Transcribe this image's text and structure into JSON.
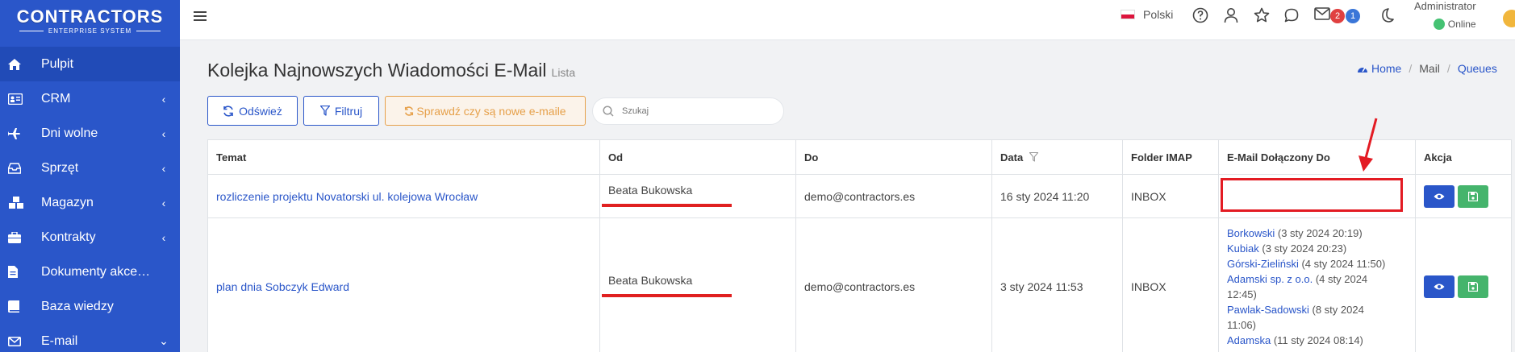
{
  "brand": {
    "title": "CONTRACTORS",
    "subtitle": "ENTERPRISE SYSTEM"
  },
  "sidebar": {
    "items": [
      {
        "label": "Pulpit",
        "icon": "home-icon",
        "active": true,
        "chevron": ""
      },
      {
        "label": "CRM",
        "icon": "id-card-icon",
        "chevron": "‹"
      },
      {
        "label": "Dni wolne",
        "icon": "plane-icon",
        "chevron": "‹"
      },
      {
        "label": "Sprzęt",
        "icon": "inbox-icon",
        "chevron": "‹"
      },
      {
        "label": "Magazyn",
        "icon": "cubes-icon",
        "chevron": "‹"
      },
      {
        "label": "Kontrakty",
        "icon": "briefcase-icon",
        "chevron": "‹"
      },
      {
        "label": "Dokumenty akcept…",
        "icon": "file-icon",
        "chevron": ""
      },
      {
        "label": "Baza wiedzy",
        "icon": "book-icon",
        "chevron": ""
      },
      {
        "label": "E-mail",
        "icon": "envelope-icon",
        "chevron": "⌄"
      }
    ]
  },
  "topbar": {
    "language": "Polski",
    "mail_badge_red": "2",
    "mail_badge_blue": "1",
    "user_name": "Administrator",
    "user_status": "Online"
  },
  "page": {
    "title": "Kolejka Najnowszych Wiadomości E-Mail",
    "subtitle": "Lista"
  },
  "breadcrumb": {
    "home": "Home",
    "mail": "Mail",
    "queues": "Queues",
    "sep": "/"
  },
  "toolbar": {
    "refresh": "Odśwież",
    "filter": "Filtruj",
    "check_new": "Sprawdź czy są nowe e-maile",
    "search_placeholder": "Szukaj"
  },
  "table": {
    "headers": [
      "Temat",
      "Od",
      "Do",
      "Data",
      "Folder IMAP",
      "E-Mail Dołączony Do",
      "Akcja"
    ],
    "rows": [
      {
        "subject": "rozliczenie projektu Novatorski ul. kolejowa Wrocław",
        "from_name": "Beata Bukowska",
        "to": "demo@contractors.es",
        "date": "16 sty 2024 11:20",
        "folder": "INBOX",
        "attached": []
      },
      {
        "subject": "plan dnia Sobczyk Edward",
        "from_name": "Beata Bukowska",
        "to": "demo@contractors.es",
        "date": "3 sty 2024 11:53",
        "folder": "INBOX",
        "attached": [
          {
            "name": "Borkowski",
            "date": "(3 sty 2024 20:19)"
          },
          {
            "name": "Kubiak",
            "date": "(3 sty 2024 20:23)"
          },
          {
            "name": "Górski-Zieliński",
            "date": "(4 sty 2024 11:50)"
          },
          {
            "name": "Adamski sp. z o.o.",
            "date": "(4 sty 2024"
          },
          {
            "name": "",
            "date": "12:45)"
          },
          {
            "name": "Pawlak-Sadowski",
            "date": "(8 sty 2024"
          },
          {
            "name": "",
            "date": "11:06)"
          },
          {
            "name": "Adamska",
            "date": "(11 sty 2024 08:14)"
          }
        ]
      }
    ]
  },
  "colors": {
    "sidebar": "#2a56c9",
    "accent": "#2a56c9",
    "warning": "#e6a04a",
    "success": "#45b46c",
    "highlight": "#e31b23"
  }
}
